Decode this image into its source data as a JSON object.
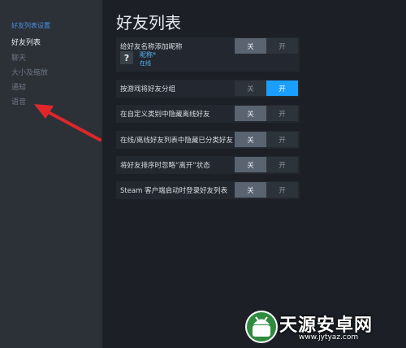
{
  "sidebar": {
    "header": "好友列表设置",
    "items": [
      {
        "label": "好友列表",
        "active": true
      },
      {
        "label": "聊天",
        "active": false
      },
      {
        "label": "大小及缩放",
        "active": false
      },
      {
        "label": "通知",
        "active": false
      },
      {
        "label": "语音",
        "active": false
      }
    ]
  },
  "main": {
    "title": "好友列表",
    "settings": [
      {
        "label": "给好友名称添加昵称",
        "off": "关",
        "on": "开",
        "value": "off",
        "preview": {
          "avatar": "?",
          "nickname": "昵称*",
          "status": "在线"
        }
      },
      {
        "label": "按游戏将好友分组",
        "off": "关",
        "on": "开",
        "value": "on"
      },
      {
        "label": "在自定义类别中隐藏离线好友",
        "off": "关",
        "on": "开",
        "value": "off"
      },
      {
        "label": "在线/离线好友列表中隐藏已分类好友",
        "off": "关",
        "on": "开",
        "value": "off"
      },
      {
        "label": "将好友排序时忽略“离开”状态",
        "off": "关",
        "on": "开",
        "value": "off"
      },
      {
        "label": "Steam 客户端启动时登录好友列表",
        "off": "关",
        "on": "开",
        "value": "off"
      }
    ]
  },
  "watermark": {
    "text": "天源安卓网",
    "url": "www.jytyaz.com"
  },
  "colors": {
    "accent": "#1a9fff",
    "arrow": "#e0262a",
    "sidebar_header": "#4a90e2"
  }
}
